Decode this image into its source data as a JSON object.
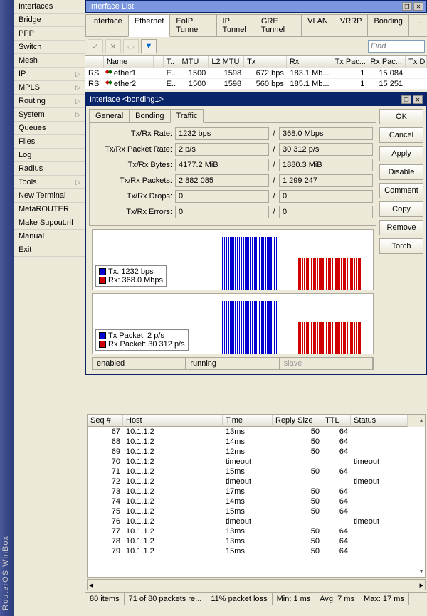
{
  "app_title": "RouterOS WinBox",
  "sidebar": {
    "items": [
      {
        "label": "Interfaces",
        "submenu": false
      },
      {
        "label": "Bridge",
        "submenu": false
      },
      {
        "label": "PPP",
        "submenu": false
      },
      {
        "label": "Switch",
        "submenu": false
      },
      {
        "label": "Mesh",
        "submenu": false
      },
      {
        "label": "IP",
        "submenu": true
      },
      {
        "label": "MPLS",
        "submenu": true
      },
      {
        "label": "Routing",
        "submenu": true
      },
      {
        "label": "System",
        "submenu": true
      },
      {
        "label": "Queues",
        "submenu": false
      },
      {
        "label": "Files",
        "submenu": false
      },
      {
        "label": "Log",
        "submenu": false
      },
      {
        "label": "Radius",
        "submenu": false
      },
      {
        "label": "Tools",
        "submenu": true
      },
      {
        "label": "New Terminal",
        "submenu": false
      },
      {
        "label": "MetaROUTER",
        "submenu": false
      },
      {
        "label": "Make Supout.rif",
        "submenu": false
      },
      {
        "label": "Manual",
        "submenu": false
      },
      {
        "label": "Exit",
        "submenu": false
      }
    ]
  },
  "list_window": {
    "title": "Interface List",
    "tabs": [
      "Interface",
      "Ethernet",
      "EoIP Tunnel",
      "IP Tunnel",
      "GRE Tunnel",
      "VLAN",
      "VRRP",
      "Bonding",
      "..."
    ],
    "active_tab": "Ethernet",
    "find_placeholder": "Find",
    "columns": [
      "",
      "Name",
      "",
      "T..",
      "MTU",
      "L2 MTU",
      "Tx",
      "Rx",
      "Tx Pac...",
      "Rx Pac...",
      "Tx Dr"
    ],
    "rows": [
      {
        "flag": "RS",
        "name": "ether1",
        "type": "E..",
        "mtu": "1500",
        "l2mtu": "1598",
        "tx": "672 bps",
        "rx": "183.1 Mb...",
        "txp": "1",
        "rxp": "15 084"
      },
      {
        "flag": "RS",
        "name": "ether2",
        "type": "E..",
        "mtu": "1500",
        "l2mtu": "1598",
        "tx": "560 bps",
        "rx": "185.1 Mb...",
        "txp": "1",
        "rxp": "15 251"
      }
    ]
  },
  "dialog": {
    "title": "Interface <bonding1>",
    "tabs": [
      "General",
      "Bonding",
      "Traffic"
    ],
    "active_tab": "Traffic",
    "buttons": [
      "OK",
      "Cancel",
      "Apply",
      "Disable",
      "Comment",
      "Copy",
      "Remove",
      "Torch"
    ],
    "stats": [
      {
        "label": "Tx/Rx Rate:",
        "a": "1232 bps",
        "b": "368.0 Mbps"
      },
      {
        "label": "Tx/Rx Packet Rate:",
        "a": "2 p/s",
        "b": "30 312 p/s"
      },
      {
        "label": "Tx/Rx Bytes:",
        "a": "4177.2 MiB",
        "b": "1880.3 MiB"
      },
      {
        "label": "Tx/Rx Packets:",
        "a": "2 882 085",
        "b": "1 299 247"
      },
      {
        "label": "Tx/Rx Drops:",
        "a": "0",
        "b": "0"
      },
      {
        "label": "Tx/Rx Errors:",
        "a": "0",
        "b": "0"
      }
    ],
    "legend1": [
      {
        "color": "#0000d0",
        "label": "Tx:  1232 bps"
      },
      {
        "color": "#d00000",
        "label": "Rx:  368.0 Mbps"
      }
    ],
    "legend2": [
      {
        "color": "#0000d0",
        "label": "Tx Packet:  2 p/s"
      },
      {
        "color": "#d00000",
        "label": "Rx Packet:  30 312 p/s"
      }
    ],
    "status": [
      "enabled",
      "running",
      "slave"
    ]
  },
  "ping": {
    "columns": [
      "Seq #",
      "Host",
      "Time",
      "Reply Size",
      "TTL",
      "Status"
    ],
    "rows": [
      {
        "seq": "67",
        "host": "10.1.1.2",
        "time": "13ms",
        "size": "50",
        "ttl": "64",
        "status": ""
      },
      {
        "seq": "68",
        "host": "10.1.1.2",
        "time": "14ms",
        "size": "50",
        "ttl": "64",
        "status": ""
      },
      {
        "seq": "69",
        "host": "10.1.1.2",
        "time": "12ms",
        "size": "50",
        "ttl": "64",
        "status": ""
      },
      {
        "seq": "70",
        "host": "10.1.1.2",
        "time": "timeout",
        "size": "",
        "ttl": "",
        "status": "timeout"
      },
      {
        "seq": "71",
        "host": "10.1.1.2",
        "time": "15ms",
        "size": "50",
        "ttl": "64",
        "status": ""
      },
      {
        "seq": "72",
        "host": "10.1.1.2",
        "time": "timeout",
        "size": "",
        "ttl": "",
        "status": "timeout"
      },
      {
        "seq": "73",
        "host": "10.1.1.2",
        "time": "17ms",
        "size": "50",
        "ttl": "64",
        "status": ""
      },
      {
        "seq": "74",
        "host": "10.1.1.2",
        "time": "14ms",
        "size": "50",
        "ttl": "64",
        "status": ""
      },
      {
        "seq": "75",
        "host": "10.1.1.2",
        "time": "15ms",
        "size": "50",
        "ttl": "64",
        "status": ""
      },
      {
        "seq": "76",
        "host": "10.1.1.2",
        "time": "timeout",
        "size": "",
        "ttl": "",
        "status": "timeout"
      },
      {
        "seq": "77",
        "host": "10.1.1.2",
        "time": "13ms",
        "size": "50",
        "ttl": "64",
        "status": ""
      },
      {
        "seq": "78",
        "host": "10.1.1.2",
        "time": "13ms",
        "size": "50",
        "ttl": "64",
        "status": ""
      },
      {
        "seq": "79",
        "host": "10.1.1.2",
        "time": "15ms",
        "size": "50",
        "ttl": "64",
        "status": ""
      }
    ],
    "footer": [
      "80 items",
      "71 of 80 packets re...",
      "11% packet loss",
      "Min: 1 ms",
      "Avg: 7 ms",
      "Max: 17 ms"
    ]
  },
  "chart_data": [
    {
      "type": "bar",
      "title": "Tx/Rx Rate",
      "series": [
        {
          "name": "Tx",
          "color": "#0000d0",
          "value_label": "1232 bps"
        },
        {
          "name": "Rx",
          "color": "#d00000",
          "value_label": "368.0 Mbps"
        }
      ],
      "pattern": "burst-then-sustained"
    },
    {
      "type": "bar",
      "title": "Tx/Rx Packet Rate",
      "series": [
        {
          "name": "Tx Packet",
          "color": "#0000d0",
          "value_label": "2 p/s"
        },
        {
          "name": "Rx Packet",
          "color": "#d00000",
          "value_label": "30 312 p/s"
        }
      ],
      "pattern": "burst-then-sustained"
    }
  ]
}
